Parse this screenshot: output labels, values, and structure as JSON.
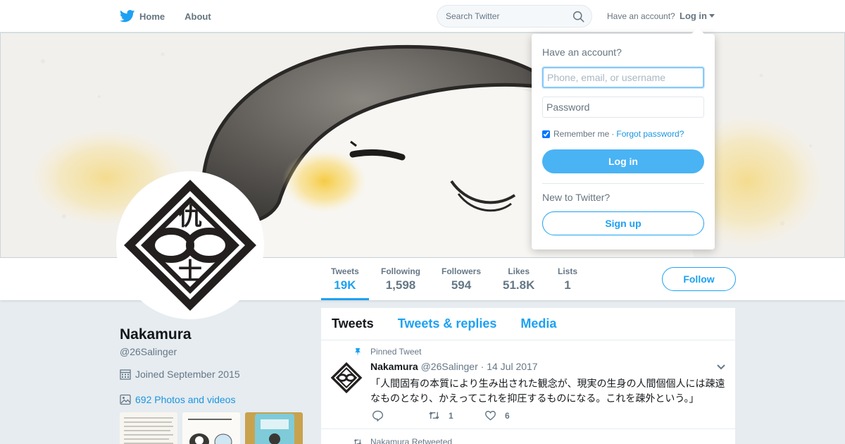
{
  "nav": {
    "home_label": "Home",
    "about_label": "About",
    "search_placeholder": "Search Twitter",
    "have_account": "Have an account?",
    "login_label": "Log in"
  },
  "profile_nav": {
    "stats": [
      {
        "label": "Tweets",
        "value": "19K",
        "active": true
      },
      {
        "label": "Following",
        "value": "1,598"
      },
      {
        "label": "Followers",
        "value": "594"
      },
      {
        "label": "Likes",
        "value": "51.8K"
      },
      {
        "label": "Lists",
        "value": "1"
      }
    ],
    "follow_label": "Follow"
  },
  "profile": {
    "name": "Nakamura",
    "handle": "@26Salinger",
    "joined": "Joined September 2015",
    "photos_link": "692 Photos and videos",
    "avatar_glyphs": [
      "仇",
      "士"
    ]
  },
  "timeline": {
    "tabs": [
      "Tweets",
      "Tweets & replies",
      "Media"
    ],
    "pinned_label": "Pinned Tweet",
    "tweet": {
      "name": "Nakamura",
      "handle": "@26Salinger",
      "separator": "·",
      "date": "14 Jul 2017",
      "text": "「人間固有の本質により生み出された観念が、現実の生身の人間個個人には疎遠なものとなり、かえってこれを抑圧するものになる。これを疎外という。」",
      "retweets": "1",
      "likes": "6"
    },
    "retweeted_label": "Nakamura Retweeted"
  },
  "login_dropdown": {
    "title": "Have an account?",
    "username_placeholder": "Phone, email, or username",
    "password_placeholder": "Password",
    "remember_label": "Remember me",
    "dot": "·",
    "forgot_label": "Forgot password?",
    "login_button": "Log in",
    "new_label": "New to Twitter?",
    "signup_button": "Sign up"
  },
  "colors": {
    "accent": "#1da1f2",
    "link": "#1b95e0",
    "login_button": "#4ab3f4",
    "background": "#e6ecf0"
  },
  "icons": [
    "twitter-bird-icon",
    "search-icon",
    "caret-down-icon",
    "calendar-icon",
    "photo-icon",
    "pin-icon",
    "chevron-down-icon",
    "reply-icon",
    "retweet-icon",
    "like-icon"
  ]
}
